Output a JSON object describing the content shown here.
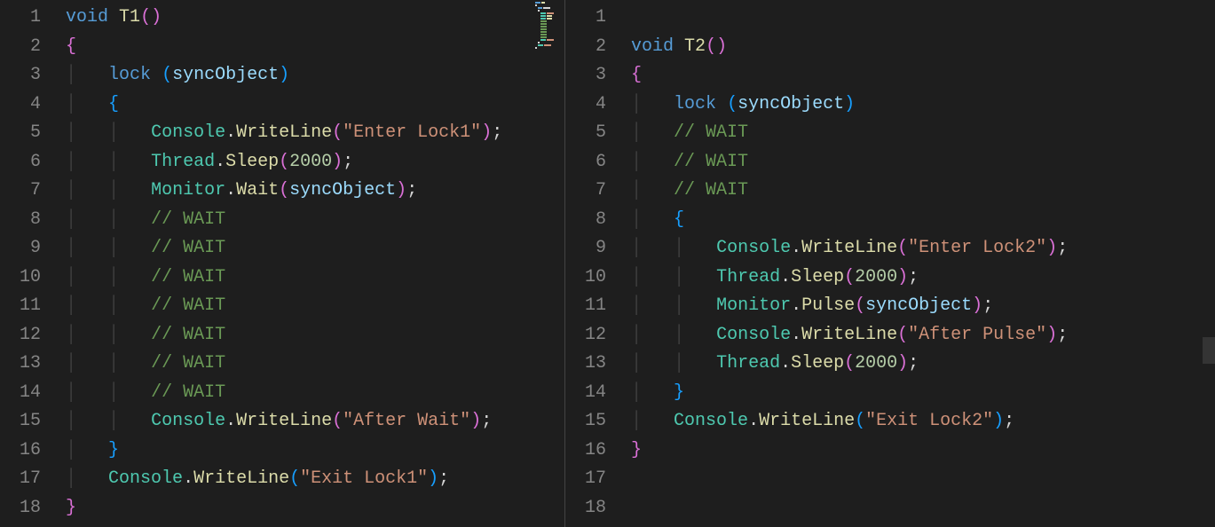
{
  "left": {
    "line_numbers": [
      "1",
      "2",
      "3",
      "4",
      "5",
      "6",
      "7",
      "8",
      "9",
      "10",
      "11",
      "12",
      "13",
      "14",
      "15",
      "16",
      "17",
      "18"
    ],
    "tokens": {
      "kw_void": "void",
      "fn_name": "T1",
      "kw_lock": "lock",
      "var_sync": "syncObject",
      "type_console": "Console",
      "fn_writeline": "WriteLine",
      "str_enter": "\"Enter Lock1\"",
      "type_thread": "Thread",
      "fn_sleep": "Sleep",
      "num_2000": "2000",
      "type_monitor": "Monitor",
      "fn_wait": "Wait",
      "cmt_wait": "// WAIT",
      "str_after": "\"After Wait\"",
      "str_exit": "\"Exit Lock1\""
    }
  },
  "right": {
    "line_numbers": [
      "1",
      "2",
      "3",
      "4",
      "5",
      "6",
      "7",
      "8",
      "9",
      "10",
      "11",
      "12",
      "13",
      "14",
      "15",
      "16",
      "17",
      "18"
    ],
    "tokens": {
      "kw_void": "void",
      "fn_name": "T2",
      "kw_lock": "lock",
      "var_sync": "syncObject",
      "cmt_wait": "// WAIT",
      "type_console": "Console",
      "fn_writeline": "WriteLine",
      "str_enter": "\"Enter Lock2\"",
      "type_thread": "Thread",
      "fn_sleep": "Sleep",
      "num_2000": "2000",
      "type_monitor": "Monitor",
      "fn_pulse": "Pulse",
      "str_after": "\"After Pulse\"",
      "str_exit": "\"Exit Lock2\""
    }
  }
}
